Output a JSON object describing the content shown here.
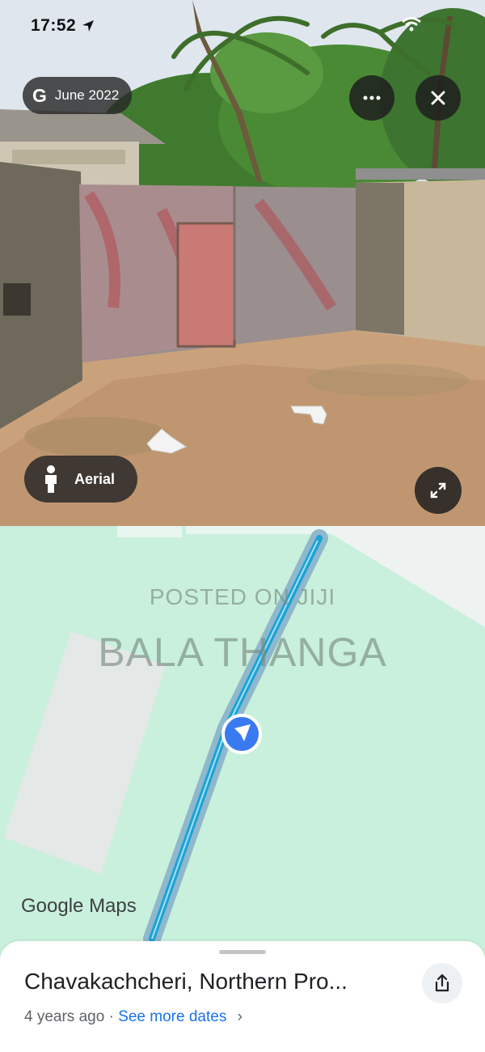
{
  "status_bar": {
    "time": "17:52"
  },
  "streetview": {
    "google_mark": "G",
    "date": "June 2022",
    "more_icon": "ellipsis-icon",
    "close_icon": "close-icon",
    "aerial_label": "Aerial",
    "pegman_icon": "pegman-icon",
    "expand_icon": "expand-icon"
  },
  "map": {
    "watermark_line1": "POSTED ON JIJI",
    "watermark_line2": "BALA THANGA",
    "logo_google": "Google",
    "logo_maps": "Maps",
    "colors": {
      "land": "#c9f0dc",
      "route": "#1aa3d6",
      "route_casing": "#8fb8cc",
      "building": "#e4e8e6",
      "location": "#3a7af0"
    }
  },
  "sheet": {
    "title": "Chavakachcheri, Northern Pro...",
    "age": "4 years ago",
    "separator": "·",
    "see_more": "See more dates",
    "chevron": "›",
    "share_icon": "share-icon"
  }
}
